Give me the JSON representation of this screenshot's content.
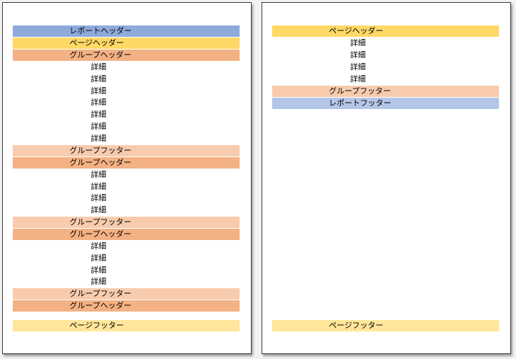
{
  "colors": {
    "report_header": "#8eaadb",
    "report_footer": "#b4c6e7",
    "page_header": "#ffd966",
    "page_footer": "#ffe699",
    "group_header": "#f4b183",
    "group_footer": "#f8cbad",
    "detail": "#ffffff"
  },
  "pages": [
    {
      "bands": [
        {
          "type": "report_header",
          "label": "レポートヘッダー"
        },
        {
          "type": "page_header",
          "label": "ページヘッダー"
        },
        {
          "type": "group_header",
          "label": "グループヘッダー"
        },
        {
          "type": "detail",
          "label": "詳細"
        },
        {
          "type": "detail",
          "label": "詳細"
        },
        {
          "type": "detail",
          "label": "詳細"
        },
        {
          "type": "detail",
          "label": "詳細"
        },
        {
          "type": "detail",
          "label": "詳細"
        },
        {
          "type": "detail",
          "label": "詳細"
        },
        {
          "type": "detail",
          "label": "詳細"
        },
        {
          "type": "group_footer",
          "label": "グループフッター"
        },
        {
          "type": "group_header",
          "label": "グループヘッダー"
        },
        {
          "type": "detail",
          "label": "詳細"
        },
        {
          "type": "detail",
          "label": "詳細"
        },
        {
          "type": "detail",
          "label": "詳細"
        },
        {
          "type": "detail",
          "label": "詳細"
        },
        {
          "type": "group_footer",
          "label": "グループフッター"
        },
        {
          "type": "group_header",
          "label": "グループヘッダー"
        },
        {
          "type": "detail",
          "label": "詳細"
        },
        {
          "type": "detail",
          "label": "詳細"
        },
        {
          "type": "detail",
          "label": "詳細"
        },
        {
          "type": "detail",
          "label": "詳細"
        },
        {
          "type": "group_footer",
          "label": "グループフッター"
        },
        {
          "type": "group_header",
          "label": "グループヘッダー"
        },
        {
          "type": "page_footer",
          "label": "ページフッター"
        }
      ]
    },
    {
      "bands": [
        {
          "type": "page_header",
          "label": "ページヘッダー"
        },
        {
          "type": "detail",
          "label": "詳細"
        },
        {
          "type": "detail",
          "label": "詳細"
        },
        {
          "type": "detail",
          "label": "詳細"
        },
        {
          "type": "detail",
          "label": "詳細"
        },
        {
          "type": "group_footer",
          "label": "グループフッター"
        },
        {
          "type": "report_footer",
          "label": "レポートフッター"
        },
        {
          "type": "page_footer",
          "label": "ページフッター"
        }
      ]
    }
  ]
}
